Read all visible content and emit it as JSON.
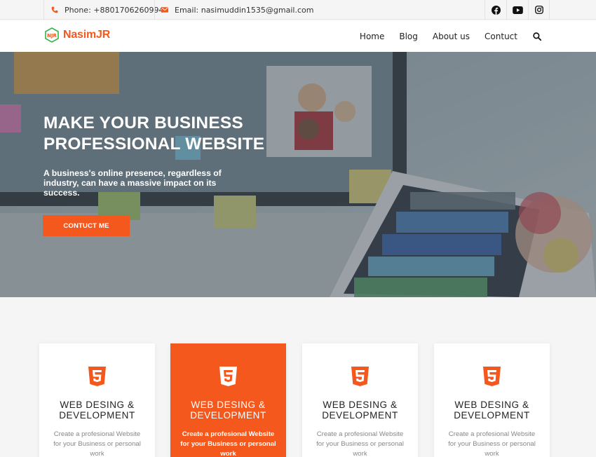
{
  "topbar": {
    "phone": "Phone: +8801706260994",
    "email": "Email: nasimuddin1535@gmail.com",
    "socials": [
      "facebook-icon",
      "youtube-icon",
      "instagram-icon"
    ]
  },
  "header": {
    "logo_text": "NasimJR",
    "nav": [
      "Home",
      "Blog",
      "About us",
      "Contuct"
    ]
  },
  "hero": {
    "title_line1": "MAKE YOUR BUSINESS",
    "title_line2": "PROFESSIONAL WEBSITE",
    "subtitle": "A business's online presence, regardless of industry, can have a massive impact on its success.",
    "button": "CONTUCT ME"
  },
  "cards": [
    {
      "title_line1": "WEB DESING &",
      "title_line2": "DEVELOPMENT",
      "text": "Create a profesional Website for your Business or personal work"
    },
    {
      "title_line1": "WEB DESING &",
      "title_line2": "DEVELOPMENT",
      "text": "Create a profesional Website for your Business or personal work"
    },
    {
      "title_line1": "WEB DESING &",
      "title_line2": "DEVELOPMENT",
      "text": "Create a profesional Website for your Business or personal work"
    },
    {
      "title_line1": "WEB DESING &",
      "title_line2": "DEVELOPMENT",
      "text": "Create a profesional Website for your Business or personal work"
    }
  ],
  "colors": {
    "accent": "#f4581d",
    "background": "#f4f5f4",
    "text": "#222222"
  }
}
